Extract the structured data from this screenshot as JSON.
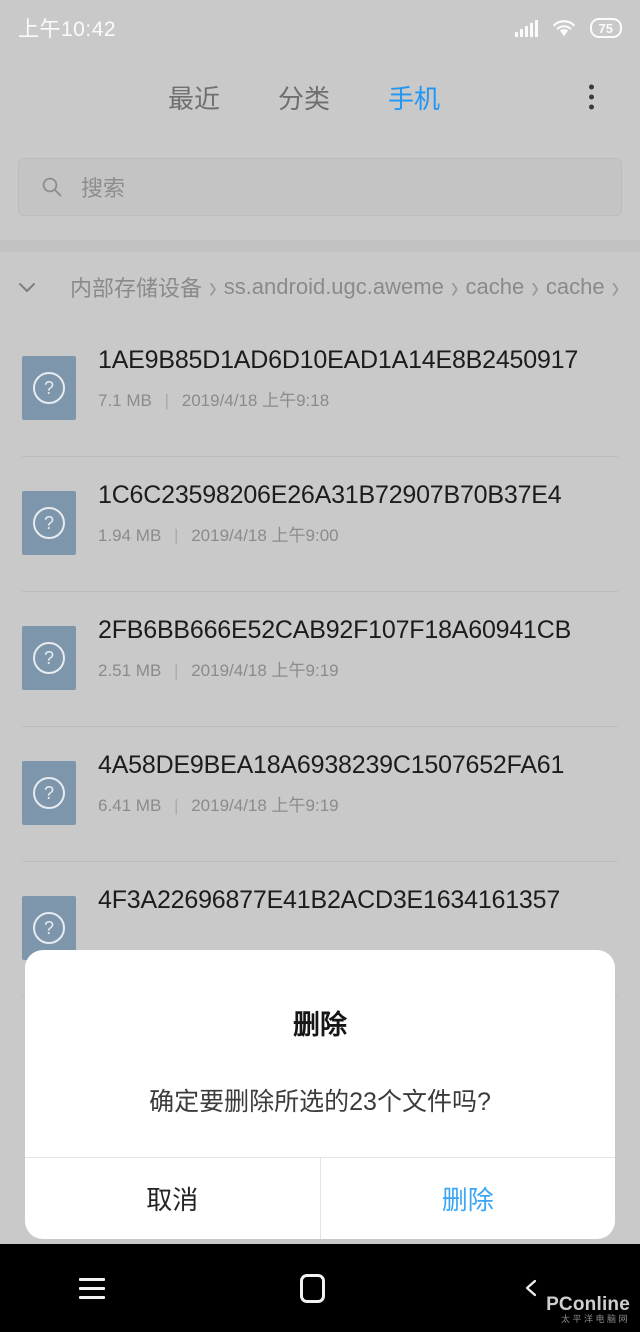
{
  "status_bar": {
    "time": "上午10:42",
    "battery_level": "75",
    "signal_icon": "signal-bars-icon",
    "wifi_icon": "wifi-icon"
  },
  "header": {
    "tabs": [
      {
        "label": "最近",
        "active": false
      },
      {
        "label": "分类",
        "active": false
      },
      {
        "label": "手机",
        "active": true
      }
    ],
    "overflow_icon": "overflow-menu-icon",
    "active_tab_color": "#2196f3"
  },
  "search": {
    "placeholder": "搜索",
    "value": "",
    "icon": "search-icon"
  },
  "breadcrumb": {
    "expand_icon": "chevron-down-icon",
    "crumbs": [
      "内部存储设备",
      "ss.android.ugc.aweme",
      "cache",
      "cache"
    ],
    "separator": "›",
    "trailing_separator": "›"
  },
  "files": [
    {
      "name": "1AE9B85D1AD6D10EAD1A14E8B2450917",
      "size": "7.1 MB",
      "date": "2019/4/18 上午9:18",
      "icon": "unknown-file-icon"
    },
    {
      "name": "1C6C23598206E26A31B72907B70B37E4",
      "size": "1.94 MB",
      "date": "2019/4/18 上午9:00",
      "icon": "unknown-file-icon"
    },
    {
      "name": "2FB6BB666E52CAB92F107F18A60941CB",
      "size": "2.51 MB",
      "date": "2019/4/18 上午9:19",
      "icon": "unknown-file-icon"
    },
    {
      "name": "4A58DE9BEA18A6938239C1507652FA61",
      "size": "6.41 MB",
      "date": "2019/4/18 上午9:19",
      "icon": "unknown-file-icon"
    },
    {
      "name": "4F3A22696877E41B2ACD3E1634161357",
      "size": "",
      "date": "",
      "icon": "unknown-file-icon"
    }
  ],
  "file_meta_divider": "|",
  "dialog": {
    "title": "删除",
    "message": "确定要删除所选的23个文件吗?",
    "cancel_label": "取消",
    "confirm_label": "删除",
    "confirm_color": "#39a5f7"
  },
  "nav_bar": {
    "menu_icon": "menu-icon",
    "home_icon": "home-icon",
    "back_icon": "back-icon"
  },
  "watermark": {
    "main": "PConline",
    "sub": "太平洋电脑网"
  }
}
